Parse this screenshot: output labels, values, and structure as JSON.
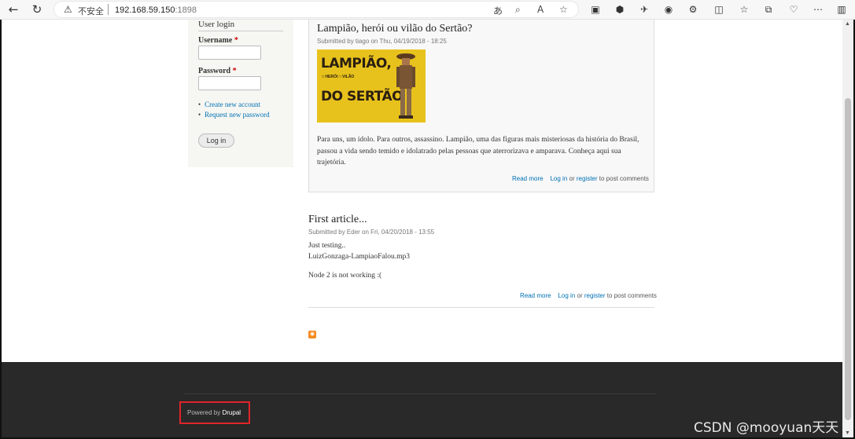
{
  "browser": {
    "security_label": "不安全",
    "host": "192.168.59.150",
    "port": ":1898"
  },
  "sidebar": {
    "title": "User login",
    "username_label": "Username",
    "password_label": "Password",
    "required_mark": "*",
    "links": [
      "Create new account",
      "Request new password"
    ],
    "login_button": "Log in"
  },
  "articles": [
    {
      "title": "Lampião, herói ou vilão do Sertão?",
      "meta": "Submitted by tiago on Thu, 04/19/2018 - 18:25",
      "image_text": [
        "LAMPIÃO,",
        "DO SERTÃO"
      ],
      "image_tags": "□ HERÓI  □ VILÃO",
      "body": "Para uns, um ídolo. Para outros, assassino. Lampião, uma das figuras mais misteriosas da história do Brasil, passou a vida sendo temido e idolatrado pelas pessoas que aterrorizava e amparava. Conheça aqui sua trajetória.",
      "read_more": "Read more",
      "log_in": "Log in",
      "or": "or",
      "register": "register",
      "post_suffix": "to post comments"
    },
    {
      "title": "First article...",
      "meta": "Submitted by Eder on Fri, 04/20/2018 - 13:55",
      "body_lines": [
        "Just testing..",
        "LuizGonzaga-LampiaoFalou.mp3",
        "",
        "Node 2 is not working :("
      ],
      "read_more": "Read more",
      "log_in": "Log in",
      "or": "or",
      "register": "register",
      "post_suffix": "to post comments"
    }
  ],
  "footer": {
    "powered_prefix": "Powered by",
    "powered_link": "Drupal"
  },
  "watermark": "CSDN @mooyuan天天"
}
